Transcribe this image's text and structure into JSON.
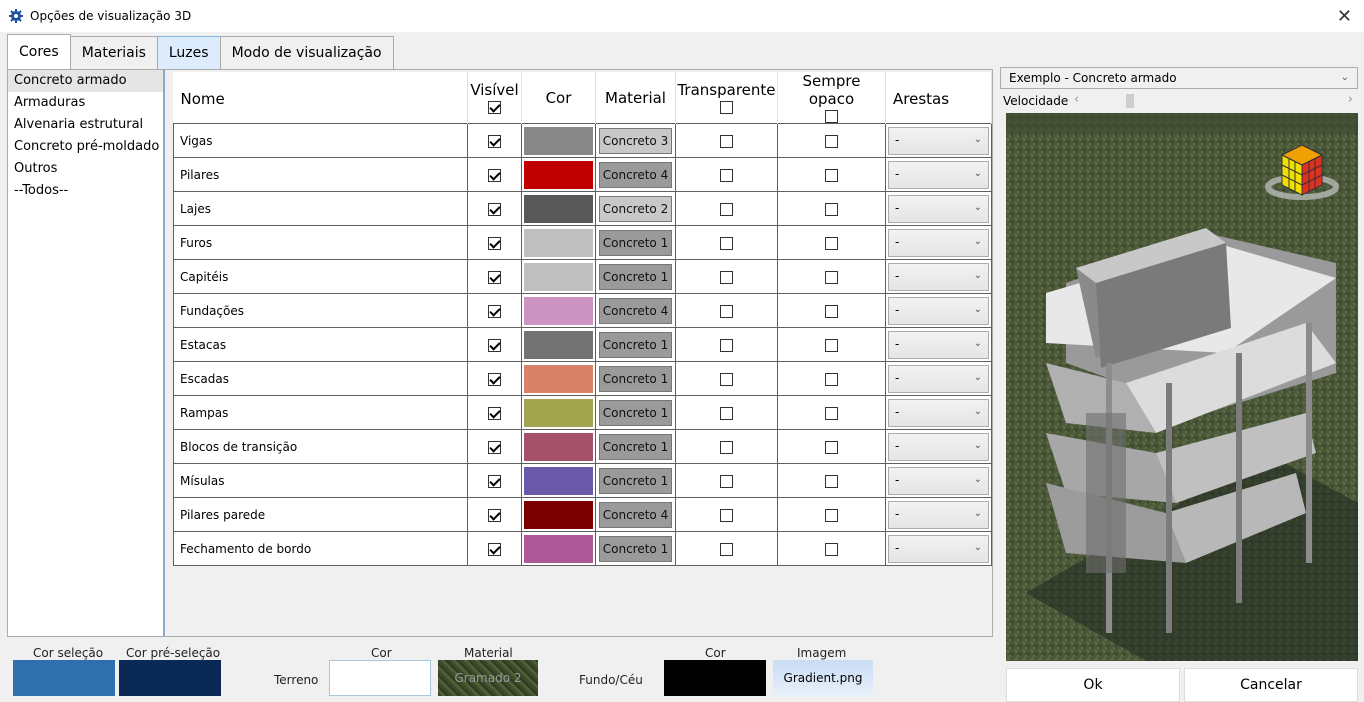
{
  "window": {
    "title": "Opções de visualização 3D"
  },
  "tabs": [
    "Cores",
    "Materiais",
    "Luzes",
    "Modo de visualização"
  ],
  "categories": [
    "Concreto armado",
    "Armaduras",
    "Alvenaria estrutural",
    "Concreto pré-moldado",
    "Outros",
    "--Todos--"
  ],
  "table": {
    "headers": {
      "name": "Nome",
      "visible": "Visível",
      "color": "Cor",
      "material": "Material",
      "transparent": "Transparente",
      "opaque": "Sempre opaco",
      "edges": "Arestas"
    },
    "rows": [
      {
        "name": "Vigas",
        "visible": true,
        "color": "#888888",
        "material": "Concreto 3",
        "light": true,
        "transparent": false,
        "opaque": false,
        "edges": "-"
      },
      {
        "name": "Pilares",
        "visible": true,
        "color": "#c00000",
        "material": "Concreto 4",
        "light": false,
        "transparent": false,
        "opaque": false,
        "edges": "-"
      },
      {
        "name": "Lajes",
        "visible": true,
        "color": "#595959",
        "material": "Concreto 2",
        "light": true,
        "transparent": false,
        "opaque": false,
        "edges": "-"
      },
      {
        "name": "Furos",
        "visible": true,
        "color": "#bfbfbf",
        "material": "Concreto 1",
        "light": false,
        "transparent": false,
        "opaque": false,
        "edges": "-"
      },
      {
        "name": "Capitéis",
        "visible": true,
        "color": "#bfbfbf",
        "material": "Concreto 1",
        "light": false,
        "transparent": false,
        "opaque": false,
        "edges": "-"
      },
      {
        "name": "Fundações",
        "visible": true,
        "color": "#cc94c0",
        "material": "Concreto 4",
        "light": false,
        "transparent": false,
        "opaque": false,
        "edges": "-"
      },
      {
        "name": "Estacas",
        "visible": true,
        "color": "#737373",
        "material": "Concreto 1",
        "light": false,
        "transparent": false,
        "opaque": false,
        "edges": "-"
      },
      {
        "name": "Escadas",
        "visible": true,
        "color": "#d9826a",
        "material": "Concreto 1",
        "light": false,
        "transparent": false,
        "opaque": false,
        "edges": "-"
      },
      {
        "name": "Rampas",
        "visible": true,
        "color": "#a3a44e",
        "material": "Concreto 1",
        "light": false,
        "transparent": false,
        "opaque": false,
        "edges": "-"
      },
      {
        "name": "Blocos de transição",
        "visible": true,
        "color": "#a45169",
        "material": "Concreto 1",
        "light": false,
        "transparent": false,
        "opaque": false,
        "edges": "-"
      },
      {
        "name": "Mísulas",
        "visible": true,
        "color": "#6a58a8",
        "material": "Concreto 1",
        "light": false,
        "transparent": false,
        "opaque": false,
        "edges": "-"
      },
      {
        "name": "Pilares parede",
        "visible": true,
        "color": "#7d0000",
        "material": "Concreto 4",
        "light": false,
        "transparent": false,
        "opaque": false,
        "edges": "-"
      },
      {
        "name": "Fechamento de bordo",
        "visible": true,
        "color": "#ae5898",
        "material": "Concreto 1",
        "light": false,
        "transparent": false,
        "opaque": false,
        "edges": "-"
      }
    ]
  },
  "bottom": {
    "selection_label": "Cor seleção",
    "preselection_label": "Cor pré-seleção",
    "selection_color": "#2f6fae",
    "preselection_color": "#0a2a55",
    "terrain_label": "Terreno",
    "terrain_color_label": "Cor",
    "terrain_material_label": "Material",
    "terrain_material": "Gramado 2",
    "sky_label": "Fundo/Céu",
    "sky_color_label": "Cor",
    "sky_image_label": "Imagem",
    "sky_image": "Gradient.png"
  },
  "preview": {
    "example": "Exemplo - Concreto armado",
    "speed_label": "Velocidade"
  },
  "buttons": {
    "ok": "Ok",
    "cancel": "Cancelar"
  }
}
